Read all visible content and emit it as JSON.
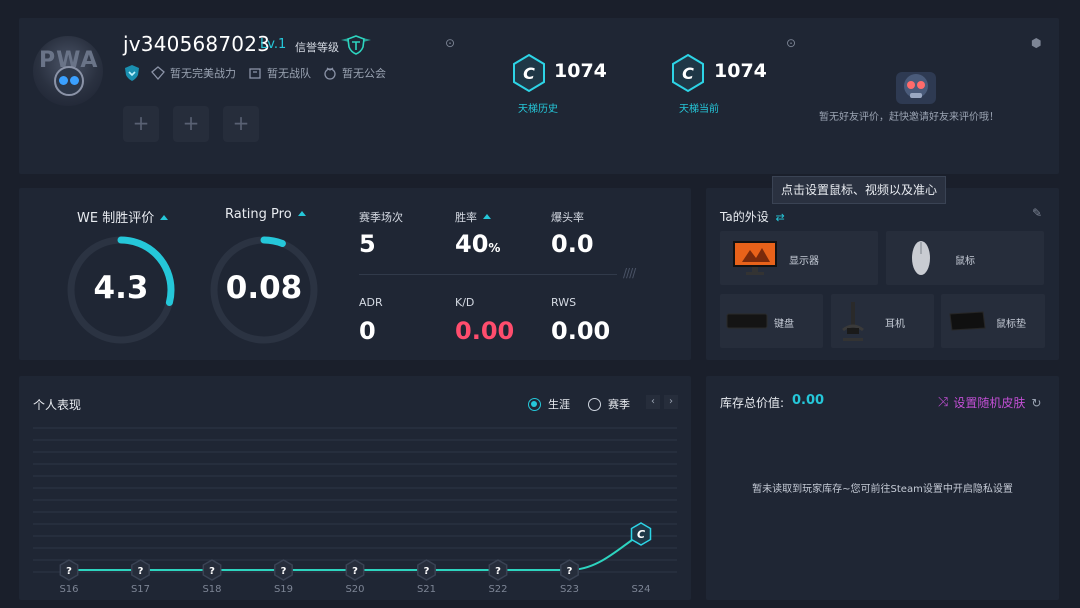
{
  "profile": {
    "username": "jv3405687023",
    "level": "Lv.1",
    "credit_label": "信誉等级",
    "avatar_text": "PWA",
    "badges": [
      "暂无完美战力",
      "暂无战队",
      "暂无公会"
    ],
    "slots": [
      "+",
      "+",
      "+"
    ],
    "ladder": [
      {
        "letter": "C",
        "value": "1074",
        "label": "天梯历史"
      },
      {
        "letter": "C",
        "value": "1074",
        "label": "天梯当前"
      }
    ],
    "friend_review": "暂无好友评价，赶快邀请好友来评价哦！"
  },
  "stats": {
    "we_label": "WE 制胜评价",
    "we_value": "4.3",
    "we_fraction": 0.29,
    "rating_label": "Rating Pro",
    "rating_value": "0.08",
    "rating_fraction": 0.06,
    "items": [
      {
        "label": "赛季场次",
        "value": "5",
        "color": "#ffffff"
      },
      {
        "label": "胜率",
        "value": "40",
        "unit": "%",
        "color": "#ffffff",
        "sortable": true
      },
      {
        "label": "爆头率",
        "value": "0.0",
        "color": "#ffffff"
      },
      {
        "label": "ADR",
        "value": "0",
        "color": "#ffffff"
      },
      {
        "label": "K/D",
        "value": "0.00",
        "color": "#ff4d6d"
      },
      {
        "label": "RWS",
        "value": "0.00",
        "color": "#ffffff"
      }
    ]
  },
  "gear": {
    "title": "Ta的外设",
    "tooltip": "点击设置鼠标、视频以及准心",
    "items": {
      "monitor": "显示器",
      "mouse": "鼠标",
      "keyboard": "键盘",
      "headset": "耳机",
      "mousepad": "鼠标垫"
    }
  },
  "performance": {
    "title": "个人表现",
    "tabs": [
      {
        "label": "生涯",
        "selected": true
      },
      {
        "label": "赛季",
        "selected": false
      }
    ],
    "prev": "‹",
    "next": "›"
  },
  "chart_data": {
    "type": "line",
    "x": [
      "S16",
      "S17",
      "S18",
      "S19",
      "S20",
      "S21",
      "S22",
      "S23",
      "S24"
    ],
    "points": [
      "?",
      "?",
      "?",
      "?",
      "?",
      "?",
      "?",
      "?",
      "C"
    ],
    "levels": [
      0,
      0,
      0,
      0,
      0,
      0,
      0,
      0,
      2
    ],
    "line_color": "#2dd4bf",
    "grid": true
  },
  "inventory": {
    "title": "库存总价值:",
    "value": "0.00",
    "skin_button": "设置随机皮肤",
    "empty": "暂未读取到玩家库存~您可前往Steam设置中开启隐私设置"
  },
  "colors": {
    "accent": "#25c7d9",
    "danger": "#ff4d6d",
    "skin": "#c24fd4"
  }
}
